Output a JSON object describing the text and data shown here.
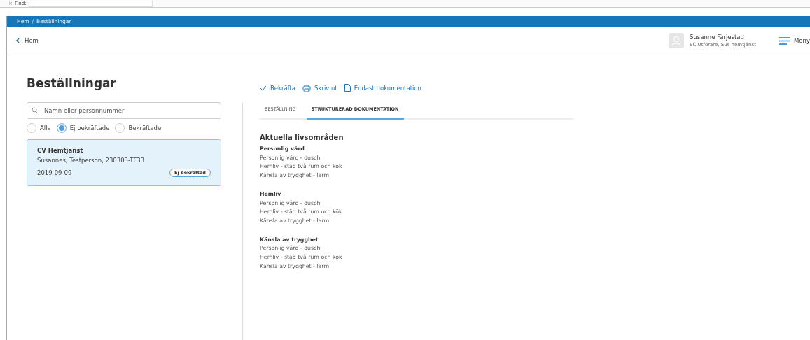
{
  "find_bar": {
    "close": "×",
    "label": "Find:"
  },
  "breadcrumb": [
    "Hem",
    "Beställningar"
  ],
  "breadcrumb_separator": "/",
  "back_link": "Hem",
  "user": {
    "name": "Susanne Färjestad",
    "role": "EC.Utförare, Sus hemtjänst"
  },
  "menu": "Meny",
  "title": "Beställningar",
  "search": {
    "placeholder": "Namn eller personnummer"
  },
  "filters": [
    {
      "label": "Alla",
      "selected": false
    },
    {
      "label": "Ej bekräftade",
      "selected": true
    },
    {
      "label": "Bekräftade",
      "selected": false
    }
  ],
  "orders": [
    {
      "title": "CV Hemtjänst",
      "person": "Susannes, Testperson, 230303-TF33",
      "date": "2019-09-09",
      "status": "Ej bekräftad",
      "selected": true
    }
  ],
  "actions": [
    {
      "kind": "check",
      "label": "Bekräfta"
    },
    {
      "kind": "print",
      "label": "Skriv ut"
    },
    {
      "kind": "document",
      "label": "Endast dokumentation"
    }
  ],
  "tabs": [
    {
      "label": "BESTÄLLNING",
      "selected": false
    },
    {
      "label": "STRUKTURERAD DOKUMENTATION",
      "selected": true
    }
  ],
  "section_title": "Aktuella livsområden",
  "groups": [
    {
      "heading": "Personlig vård",
      "items": [
        "Personlig vård - dusch",
        "Hemliv - städ två rum och kök",
        "Känsla av trygghet - larm"
      ]
    },
    {
      "heading": "Hemliv",
      "items": [
        "Personlig vård - dusch",
        "Hemliv - städ två rum och kök",
        "Känsla av trygghet - larm"
      ]
    },
    {
      "heading": "Känsla av trygghet",
      "items": [
        "Personlig vård - dusch",
        "Hemliv - städ två rum och kök",
        "Känsla av trygghet - larm"
      ]
    }
  ]
}
